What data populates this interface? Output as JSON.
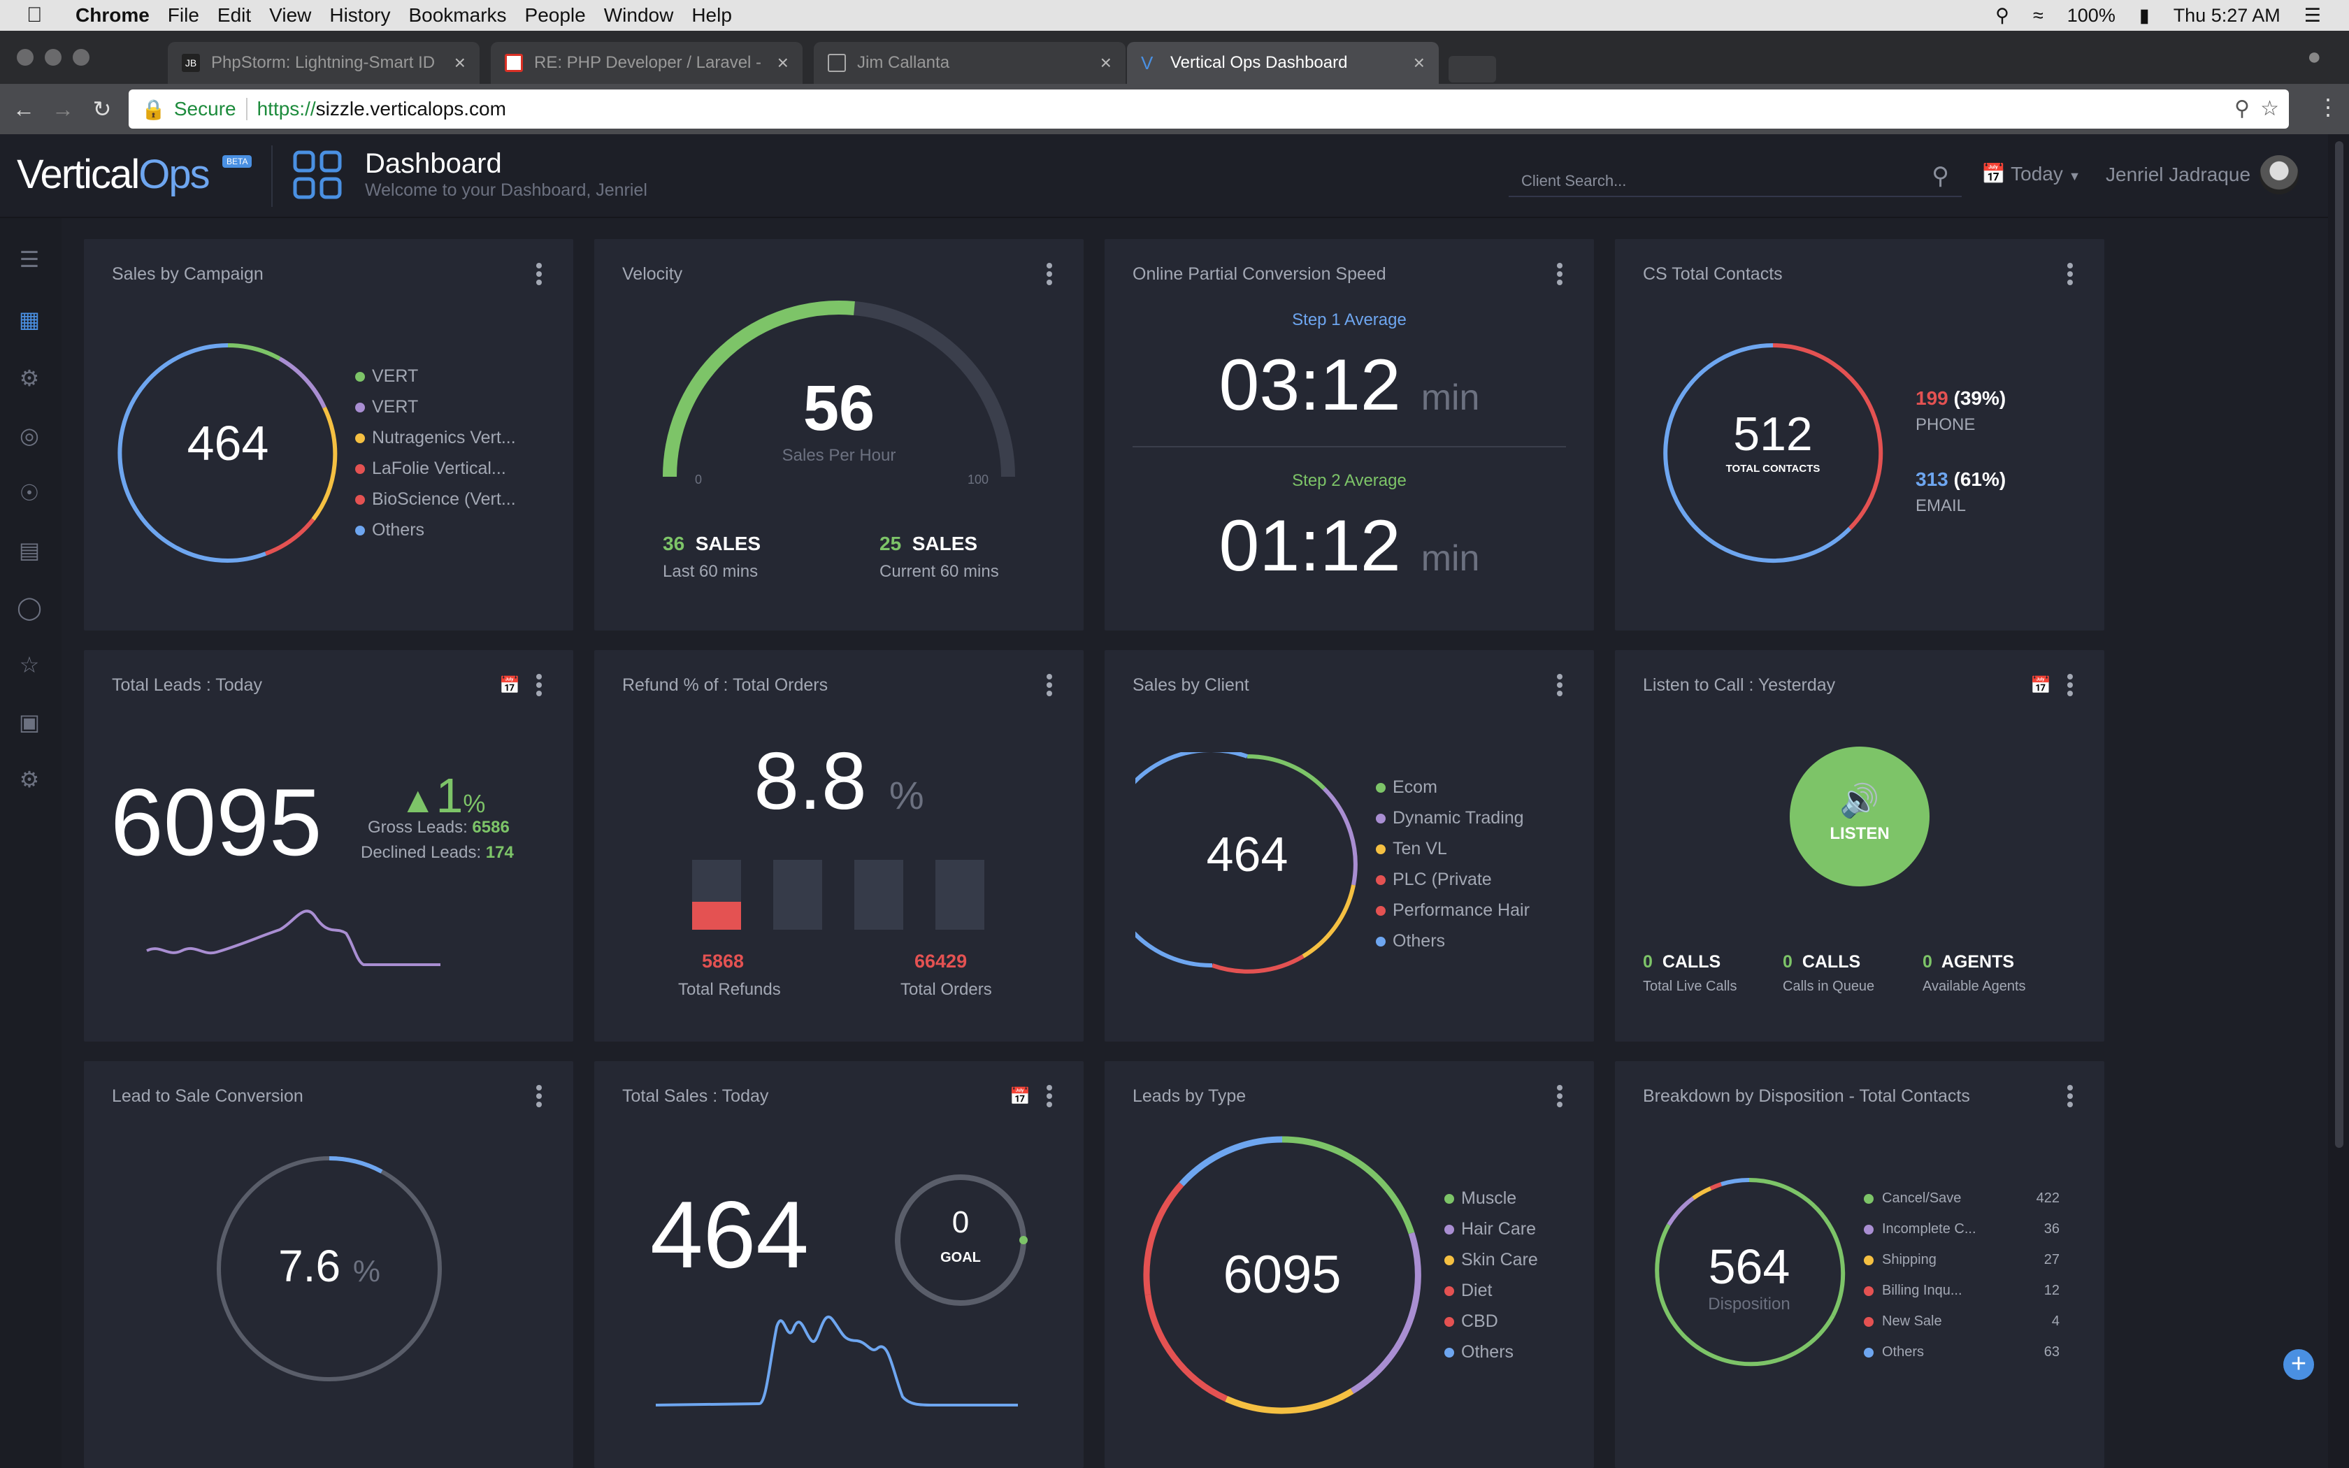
{
  "menubar": {
    "app": "Chrome",
    "items": [
      "File",
      "Edit",
      "View",
      "History",
      "Bookmarks",
      "People",
      "Window",
      "Help"
    ],
    "battery": "100%",
    "clock": "Thu 5:27 AM"
  },
  "tabs": [
    {
      "label": "PhpStorm: Lightning-Smart ID"
    },
    {
      "label": "RE: PHP Developer / Laravel -"
    },
    {
      "label": "Jim Callanta"
    },
    {
      "label": "Vertical Ops Dashboard"
    }
  ],
  "address": {
    "secure": "Secure",
    "url": "https://sizzle.verticalops.com",
    "proto": "https://",
    "host": "sizzle.verticalops.com"
  },
  "header": {
    "logo_a": "Vertical",
    "logo_b": "Ops",
    "beta": "BETA",
    "title": "Dashboard",
    "subtitle": "Welcome to your Dashboard, Jenriel",
    "search_placeholder": "Client Search...",
    "date_filter": "Today",
    "user": "Jenriel Jadraque"
  },
  "colors": {
    "green": "#7dc468",
    "purple": "#a98ed2",
    "yellow": "#f5c042",
    "red": "#e45252",
    "blue": "#6ea6f0",
    "bg": "#1d1f27",
    "card": "#252833"
  },
  "cards": {
    "sales_campaign": {
      "title": "Sales by Campaign",
      "value": "464",
      "legend": [
        {
          "label": "VERT",
          "color": "#7dc468"
        },
        {
          "label": "VERT",
          "color": "#a98ed2"
        },
        {
          "label": "Nutragenics Vert...",
          "color": "#f5c042"
        },
        {
          "label": "LaFolie Vertical...",
          "color": "#e45252"
        },
        {
          "label": "BioScience (Vert...",
          "color": "#e45252"
        },
        {
          "label": "Others",
          "color": "#6ea6f0"
        }
      ]
    },
    "velocity": {
      "title": "Velocity",
      "value": "56",
      "sub": "Sales Per Hour",
      "min": "0",
      "max": "100",
      "level": 0.56,
      "left_num": "36",
      "left_unit": "SALES",
      "left_sub": "Last 60 mins",
      "right_num": "25",
      "right_unit": "SALES",
      "right_sub": "Current 60 mins"
    },
    "conversion_speed": {
      "title": "Online Partial Conversion Speed",
      "step1": "Step 1 Average",
      "t1": "03:12",
      "u1": "min",
      "step2": "Step 2 Average",
      "t2": "01:12",
      "u2": "min"
    },
    "cs_contacts": {
      "title": "CS Total Contacts",
      "value": "512",
      "sub": "TOTAL CONTACTS",
      "phone_num": "199",
      "phone_pct": "(39%)",
      "phone_label": "PHONE",
      "email_num": "313",
      "email_pct": "(61%)",
      "email_label": "EMAIL"
    },
    "total_leads": {
      "title": "Total Leads : Today",
      "value": "6095",
      "delta": "1",
      "delta_unit": "%",
      "gross_label": "Gross Leads:",
      "gross": "6586",
      "declined_label": "Declined Leads:",
      "declined": "174"
    },
    "refund": {
      "title": "Refund % of : Total Orders",
      "value": "8.8",
      "unit": "%",
      "refunds": "5868",
      "refunds_label": "Total Refunds",
      "orders": "66429",
      "orders_label": "Total Orders"
    },
    "sales_client": {
      "title": "Sales by Client",
      "value": "464",
      "legend": [
        {
          "label": "Ecom",
          "color": "#7dc468"
        },
        {
          "label": "Dynamic Trading",
          "color": "#a98ed2"
        },
        {
          "label": "Ten VL",
          "color": "#f5c042"
        },
        {
          "label": "PLC (Private",
          "color": "#e45252"
        },
        {
          "label": "Performance Hair",
          "color": "#e45252"
        },
        {
          "label": "Others",
          "color": "#6ea6f0"
        }
      ]
    },
    "listen": {
      "title": "Listen to Call : Yesterday",
      "button": "LISTEN",
      "c1n": "0",
      "c1u": "CALLS",
      "c1s": "Total Live Calls",
      "c2n": "0",
      "c2u": "CALLS",
      "c2s": "Calls in Queue",
      "c3n": "0",
      "c3u": "AGENTS",
      "c3s": "Available Agents"
    },
    "lead_sale": {
      "title": "Lead to Sale Conversion",
      "value": "7.6",
      "unit": "%"
    },
    "total_sales": {
      "title": "Total Sales : Today",
      "value": "464",
      "goal": "0",
      "goal_label": "GOAL"
    },
    "leads_type": {
      "title": "Leads by Type",
      "value": "6095",
      "legend": [
        {
          "label": "Muscle",
          "color": "#7dc468"
        },
        {
          "label": "Hair Care",
          "color": "#a98ed2"
        },
        {
          "label": "Skin Care",
          "color": "#f5c042"
        },
        {
          "label": "Diet",
          "color": "#e45252"
        },
        {
          "label": "CBD",
          "color": "#e45252"
        },
        {
          "label": "Others",
          "color": "#6ea6f0"
        }
      ]
    },
    "disposition": {
      "title": "Breakdown by Disposition - Total Contacts",
      "value": "564",
      "sub": "Disposition",
      "rows": [
        {
          "label": "Cancel/Save",
          "count": "422",
          "color": "#7dc468"
        },
        {
          "label": "Incomplete C...",
          "count": "36",
          "color": "#a98ed2"
        },
        {
          "label": "Shipping",
          "count": "27",
          "color": "#f5c042"
        },
        {
          "label": "Billing Inqu...",
          "count": "12",
          "color": "#e45252"
        },
        {
          "label": "New Sale",
          "count": "4",
          "color": "#e45252"
        },
        {
          "label": "Others",
          "count": "63",
          "color": "#6ea6f0"
        }
      ]
    }
  }
}
